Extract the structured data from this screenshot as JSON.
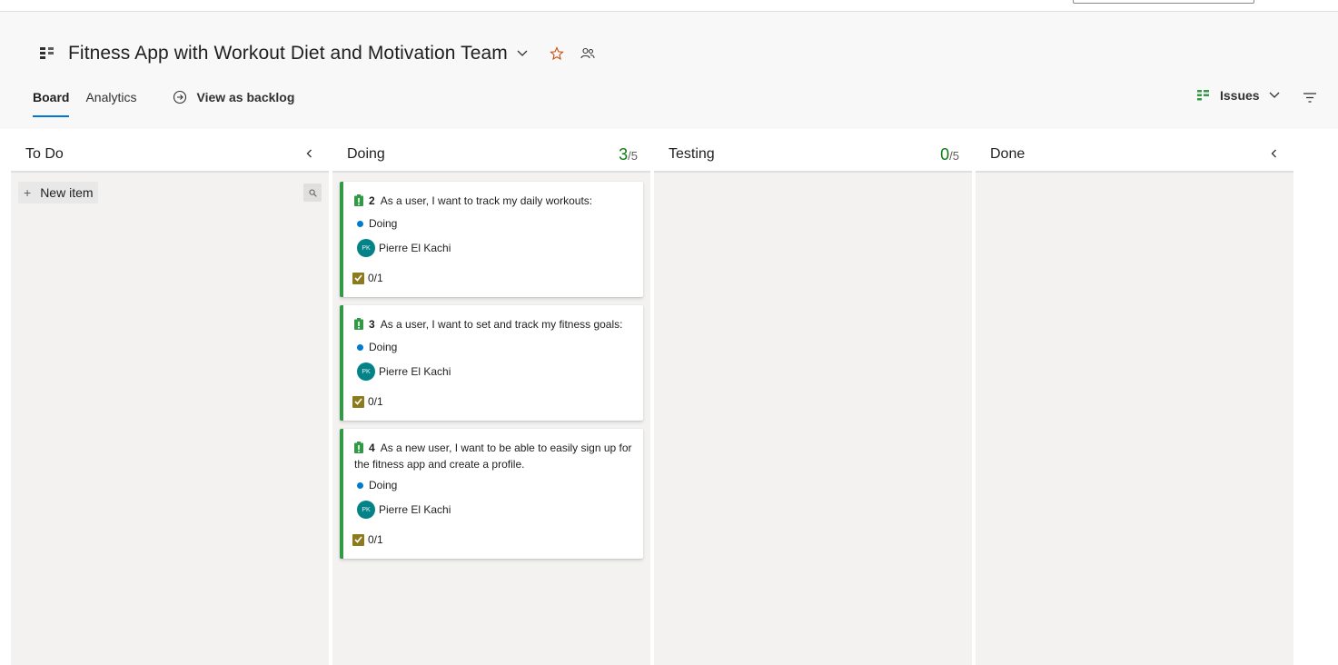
{
  "header": {
    "title": "Fitness App with Workout Diet and Motivation Team",
    "tabs": [
      {
        "label": "Board"
      },
      {
        "label": "Analytics"
      }
    ],
    "view_backlog_label": "View as backlog",
    "backlog_level": "Issues"
  },
  "columns": [
    {
      "name": "To Do",
      "new_item_label": "New item"
    },
    {
      "name": "Doing",
      "wip_count": "3",
      "wip_limit": "/5"
    },
    {
      "name": "Testing",
      "wip_count": "0",
      "wip_limit": "/5"
    },
    {
      "name": "Done"
    }
  ],
  "cards": [
    {
      "id": "2",
      "title": "As a user, I want to track my daily workouts:",
      "state": "Doing",
      "assignee": "Pierre El Kachi",
      "initials": "PK",
      "tasks": "0/1"
    },
    {
      "id": "3",
      "title": "As a user, I want to set and track my fitness goals:",
      "state": "Doing",
      "assignee": "Pierre El Kachi",
      "initials": "PK",
      "tasks": "0/1"
    },
    {
      "id": "4",
      "title": "As a new user, I want to be able to easily sign up for the fitness app and create a profile.",
      "state": "Doing",
      "assignee": "Pierre El Kachi",
      "initials": "PK",
      "tasks": "0/1"
    }
  ],
  "colors": {
    "accent": "#0078d4",
    "card_border": "#339947",
    "wip_ok": "#107c10",
    "state_doing": "#007acc",
    "avatar": "#038387",
    "task_icon": "#8c7b1c"
  },
  "icons": [
    "team-icon",
    "chevron-down-icon",
    "star-icon",
    "team-members-icon",
    "arrow-circle-right-icon",
    "backlog-level-icon",
    "filter-icon",
    "collapse-left-icon",
    "plus-icon",
    "search-icon",
    "issue-icon",
    "task-check-icon"
  ]
}
